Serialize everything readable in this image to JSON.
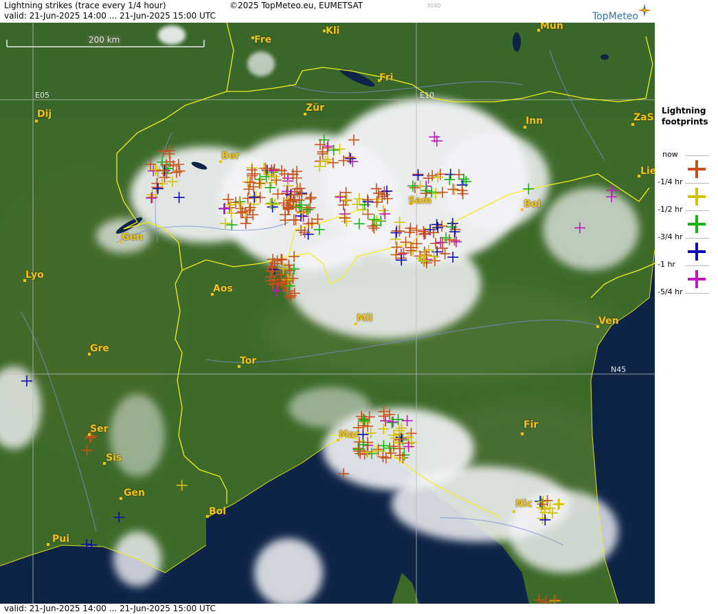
{
  "header": {
    "title": "Lightning strikes (trace every 1/4 hour)",
    "valid": "valid:  21-Jun-2025 14:00 ... 21-Jun-2025 15:00 UTC",
    "copyright": "©2025 TopMeteo.eu, EUMETSAT",
    "code": "3040",
    "logo": "TopMeteo"
  },
  "footer": {
    "valid": "valid:  21-Jun-2025 14:00 ... 21-Jun-2025 15:00 UTC"
  },
  "scale": {
    "label": "200 km"
  },
  "grid": {
    "lon1": "E05",
    "lon2": "E10",
    "lat": "N45"
  },
  "cities": [
    "Fre",
    "Kli",
    "Mün",
    "Fri",
    "Dij",
    "Zür",
    "Inn",
    "ZaS",
    "Ber",
    "Lie",
    "Sam",
    "Bol",
    "Gen",
    "Lyo",
    "Aos",
    "Mil",
    "Ven",
    "Gre",
    "Tor",
    "Ser",
    "Sis",
    "Gen",
    "Bol",
    "Pui",
    "Nic",
    "Mar",
    "Fir"
  ],
  "legend": {
    "title_line1": "Lightning",
    "title_line2": "footprints",
    "items": [
      {
        "label": "now",
        "color": "#c8501a"
      },
      {
        "label": "-1/4 hr",
        "color": "#d4c200"
      },
      {
        "label": "-1/2 hr",
        "color": "#11b511"
      },
      {
        "label": "-3/4 hr",
        "color": "#0a0ab5"
      },
      {
        "label": "-1 hr",
        "color": "#c018c0"
      },
      {
        "label": "-5/4 hr",
        "color": ""
      }
    ]
  },
  "colors": {
    "land": "#3f6b2a",
    "sea": "#0f2646",
    "border": "#f2ee1c",
    "accent": "#2f77b0"
  },
  "icons": [
    "compass-icon",
    "lightning-strike-icon"
  ]
}
